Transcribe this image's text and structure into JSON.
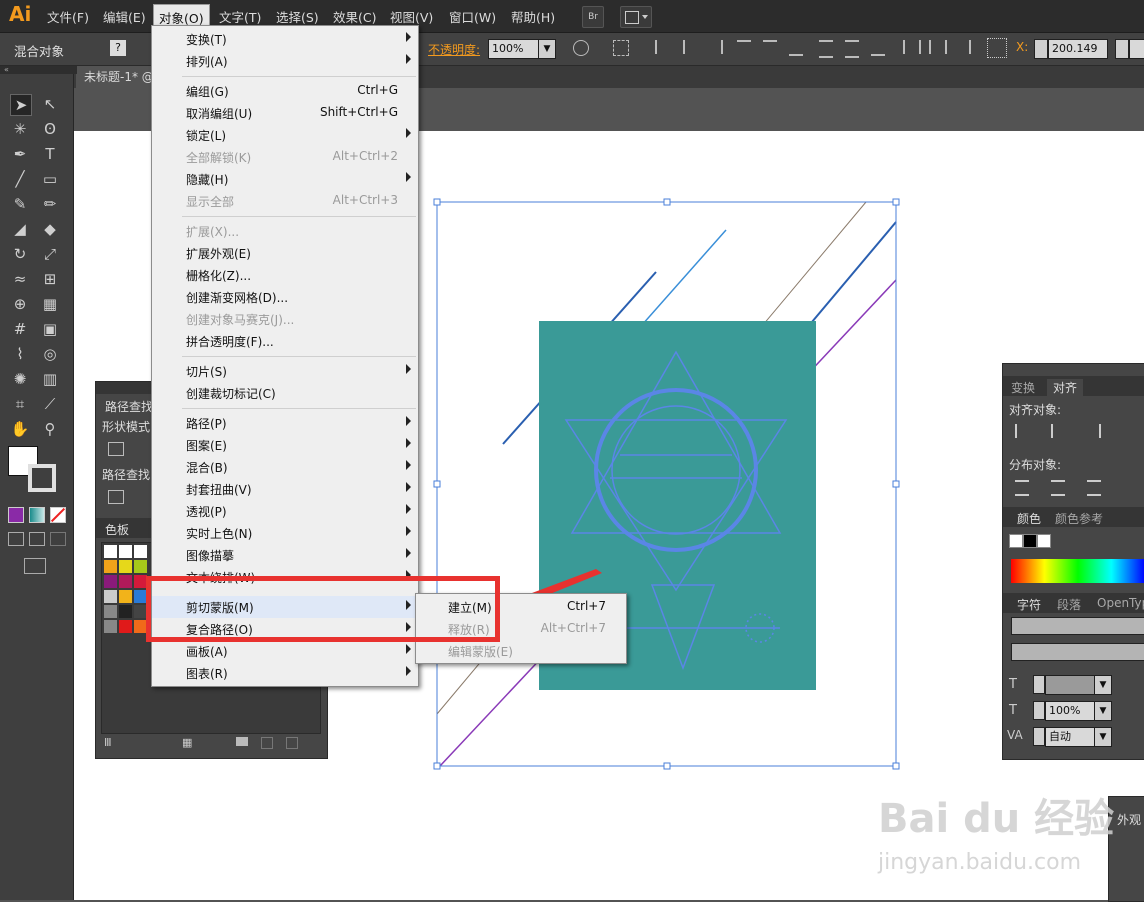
{
  "app": {
    "logo": "Ai"
  },
  "menubar": {
    "items": [
      "文件(F)",
      "编辑(E)",
      "对象(O)",
      "文字(T)",
      "选择(S)",
      "效果(C)",
      "视图(V)",
      "窗口(W)",
      "帮助(H)"
    ],
    "bridge_label": "Br"
  },
  "controlbar": {
    "title": "混合对象",
    "opacity_label": "不透明度:",
    "opacity_value": "100%",
    "x_label": "X:",
    "x_value": "200.149"
  },
  "document": {
    "tab_title": "未标题-1* @"
  },
  "object_menu": {
    "items": [
      {
        "label": "变换(T)",
        "shortcut": "",
        "submenu": true,
        "disabled": false
      },
      {
        "label": "排列(A)",
        "shortcut": "",
        "submenu": true,
        "disabled": false
      },
      {
        "label": "编组(G)",
        "shortcut": "Ctrl+G",
        "submenu": false,
        "disabled": false
      },
      {
        "label": "取消编组(U)",
        "shortcut": "Shift+Ctrl+G",
        "submenu": false,
        "disabled": false
      },
      {
        "label": "锁定(L)",
        "shortcut": "",
        "submenu": true,
        "disabled": false
      },
      {
        "label": "全部解锁(K)",
        "shortcut": "Alt+Ctrl+2",
        "submenu": false,
        "disabled": true
      },
      {
        "label": "隐藏(H)",
        "shortcut": "",
        "submenu": true,
        "disabled": false
      },
      {
        "label": "显示全部",
        "shortcut": "Alt+Ctrl+3",
        "submenu": false,
        "disabled": true
      },
      {
        "label": "扩展(X)...",
        "shortcut": "",
        "submenu": false,
        "disabled": true
      },
      {
        "label": "扩展外观(E)",
        "shortcut": "",
        "submenu": false,
        "disabled": false
      },
      {
        "label": "栅格化(Z)...",
        "shortcut": "",
        "submenu": false,
        "disabled": false
      },
      {
        "label": "创建渐变网格(D)...",
        "shortcut": "",
        "submenu": false,
        "disabled": false
      },
      {
        "label": "创建对象马赛克(J)...",
        "shortcut": "",
        "submenu": false,
        "disabled": true
      },
      {
        "label": "拼合透明度(F)...",
        "shortcut": "",
        "submenu": false,
        "disabled": false
      },
      {
        "label": "切片(S)",
        "shortcut": "",
        "submenu": true,
        "disabled": false
      },
      {
        "label": "创建裁切标记(C)",
        "shortcut": "",
        "submenu": false,
        "disabled": false
      },
      {
        "label": "路径(P)",
        "shortcut": "",
        "submenu": true,
        "disabled": false
      },
      {
        "label": "图案(E)",
        "shortcut": "",
        "submenu": true,
        "disabled": false
      },
      {
        "label": "混合(B)",
        "shortcut": "",
        "submenu": true,
        "disabled": false
      },
      {
        "label": "封套扭曲(V)",
        "shortcut": "",
        "submenu": true,
        "disabled": false
      },
      {
        "label": "透视(P)",
        "shortcut": "",
        "submenu": true,
        "disabled": false
      },
      {
        "label": "实时上色(N)",
        "shortcut": "",
        "submenu": true,
        "disabled": false
      },
      {
        "label": "图像描摹",
        "shortcut": "",
        "submenu": true,
        "disabled": false
      },
      {
        "label": "文本绕排(W)",
        "shortcut": "",
        "submenu": true,
        "disabled": false
      },
      {
        "label": "剪切蒙版(M)",
        "shortcut": "",
        "submenu": true,
        "disabled": false
      },
      {
        "label": "复合路径(O)",
        "shortcut": "",
        "submenu": true,
        "disabled": false
      },
      {
        "label": "画板(A)",
        "shortcut": "",
        "submenu": true,
        "disabled": false
      },
      {
        "label": "图表(R)",
        "shortcut": "",
        "submenu": true,
        "disabled": false
      }
    ]
  },
  "clipping_submenu": {
    "items": [
      {
        "label": "建立(M)",
        "shortcut": "Ctrl+7",
        "disabled": false
      },
      {
        "label": "释放(R)",
        "shortcut": "Alt+Ctrl+7",
        "disabled": true
      },
      {
        "label": "编辑蒙版(E)",
        "shortcut": "",
        "disabled": true
      }
    ]
  },
  "pathfinder_panel": {
    "title": "路径查找",
    "shape_modes_label": "形状模式",
    "pathfinders_label": "路径查找"
  },
  "swatches_panel": {
    "tab": "色板"
  },
  "align_panel": {
    "tabs": [
      "变换",
      "对齐"
    ],
    "align_objects_label": "对齐对象:",
    "distribute_objects_label": "分布对象:"
  },
  "color_panel": {
    "tabs": [
      "颜色",
      "颜色参考"
    ]
  },
  "character_panel": {
    "tabs": [
      "字符",
      "段落",
      "OpenTyp"
    ],
    "leading_value": "100%",
    "tracking_value": "自动"
  },
  "appearance_panel": {
    "title": "外观"
  },
  "watermark": {
    "text": "Bai du 经验",
    "url": "jingyan.baidu.com"
  },
  "colors": {
    "teal": "#3a9a97",
    "accent_red": "#e8322f",
    "selection_blue": "#4a7fd8"
  }
}
